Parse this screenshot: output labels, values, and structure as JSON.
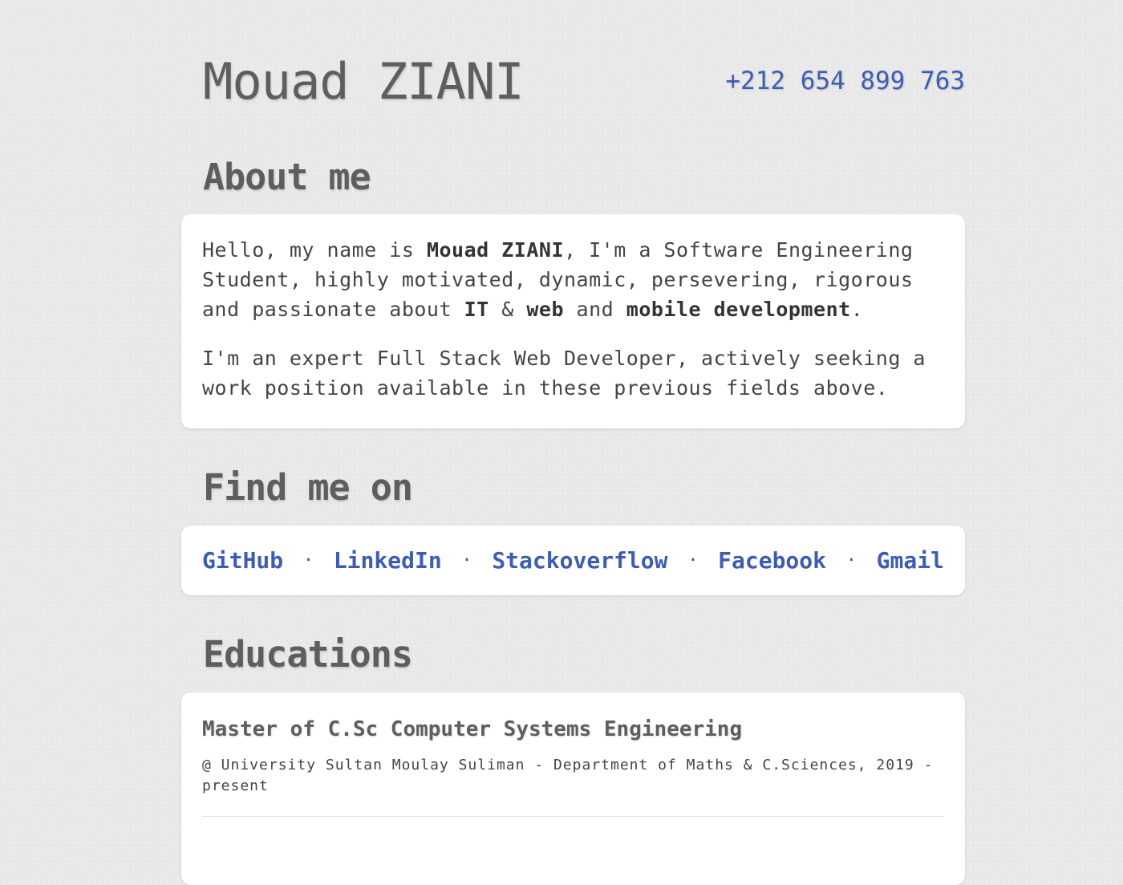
{
  "header": {
    "name": "Mouad ZIANI",
    "phone": "+212 654 899 763"
  },
  "about": {
    "title": "About me",
    "p1": {
      "t1": "Hello, my name is ",
      "b1": "Mouad ZIANI",
      "t2": ", I'm a Software Engineering Student, highly motivated, dynamic, persevering, rigorous and passionate about ",
      "b2": "IT",
      "t3": " & ",
      "b3": "web",
      "t4": " and ",
      "b4": "mobile development",
      "t5": "."
    },
    "p2": "I'm an expert Full Stack Web Developer, actively seeking a work position available in these previous fields above."
  },
  "find_me": {
    "title": "Find me on",
    "separator": "·",
    "links": [
      "GitHub",
      "LinkedIn",
      "Stackoverflow",
      "Facebook",
      "Gmail"
    ]
  },
  "education": {
    "title": "Educations",
    "items": [
      {
        "degree": "Master of C.Sc Computer Systems Engineering",
        "detail": "@ University Sultan Moulay Suliman - Department of Maths & C.Sciences, 2019 - present"
      }
    ]
  },
  "colors": {
    "background": "#e9e9e9",
    "text": "#444444",
    "heading": "#5e5e5e",
    "link": "#3d5db4",
    "card": "#ffffff"
  }
}
